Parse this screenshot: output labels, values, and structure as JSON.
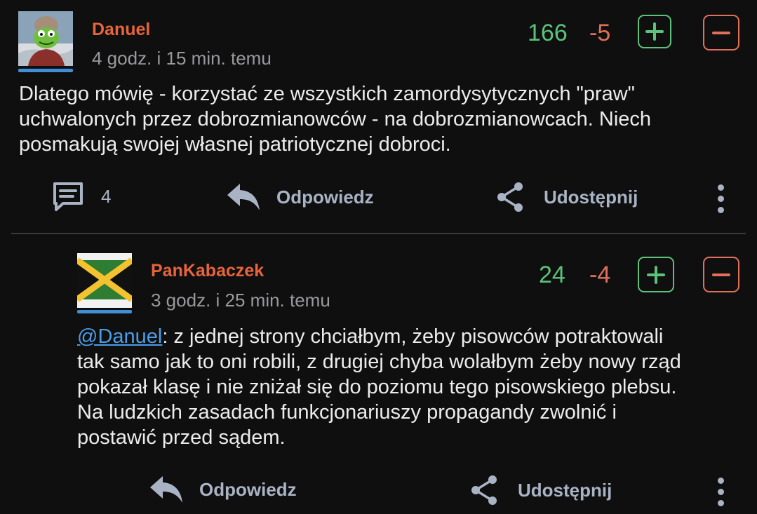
{
  "comments": [
    {
      "author": "Danuel",
      "time": "4 godz. i 15 min. temu",
      "score_up": "166",
      "score_down": "-5",
      "body_lines": [
        "Dlatego mówię - korzystać ze wszystkich zamordysytycznych \"praw\"",
        "uchwalonych przez dobrozmianowców - na dobrozmianowcach. Niech",
        "posmakują swojej własnej patriotycznej dobroci."
      ],
      "reply_count": "4",
      "reply_label": "Odpowiedz",
      "share_label": "Udostępnij",
      "avatar_icon": "kermit-avatar-icon"
    },
    {
      "author": "PanKabaczek",
      "time": "3 godz. i 25 min. temu",
      "score_up": "24",
      "score_down": "-4",
      "mention": "@Danuel",
      "body_first_rest": ": z jednej strony chciałbym, żeby pisowców potraktowali",
      "body_lines": [
        "tak samo jak to oni robili, z drugiej chyba wolałbym żeby nowy rząd",
        "pokazał klasę i nie zniżał się do poziomu tego pisowskiego plebsu.",
        "Na ludzkich zasadach funkcjonariuszy propagandy zwolnić i",
        "postawić przed sądem."
      ],
      "reply_label": "Odpowiedz",
      "share_label": "Udostępnij",
      "avatar_icon": "jamaica-flag-avatar-icon"
    }
  ],
  "colors": {
    "background": "#0f0f10",
    "author": "#e8643a",
    "upvote": "#5cc27a",
    "downvote": "#e0705a",
    "mention": "#4a9ee8",
    "action": "#a9b3c4"
  }
}
